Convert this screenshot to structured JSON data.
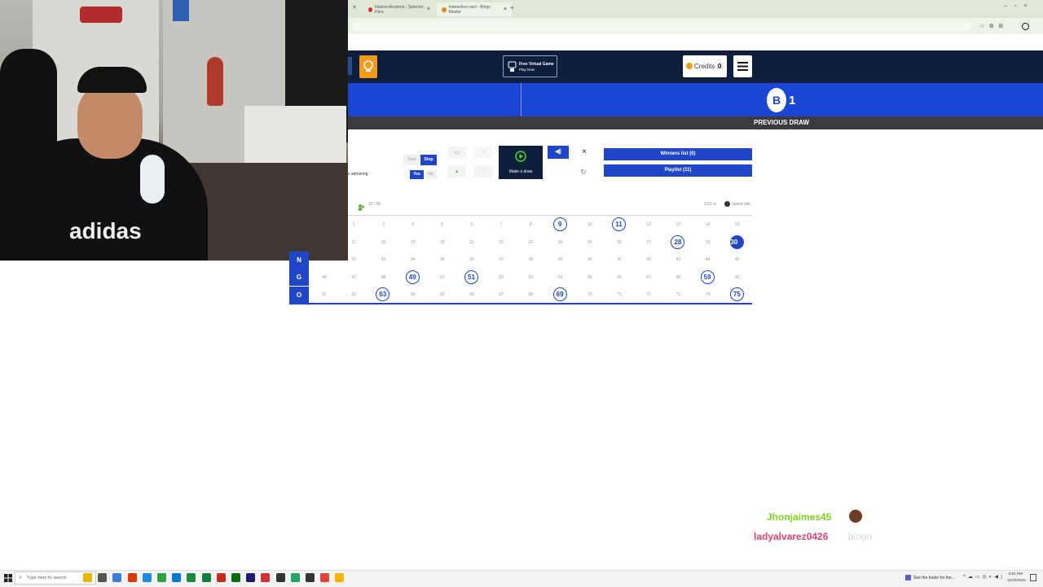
{
  "browser": {
    "tabs": [
      {
        "title": "Nuleva Aleatoria - Selector Peru",
        "color": "#d33030"
      },
      {
        "title": "Interactive card - Bingo Master",
        "color": "#e08a1e"
      }
    ],
    "new_tab_label": "+",
    "close_label": "×"
  },
  "header": {
    "promo_title": "Free Virtual Game",
    "promo_sub": "Play Now",
    "credits_label": "Credits :",
    "credits_value": "0"
  },
  "banner": {
    "last_letter": "B",
    "last_number": "1",
    "previous_label": "PREVIOUS DRAW"
  },
  "controls": {
    "start_label": "Start",
    "stop_label": "Stop",
    "yes_label": "Yes",
    "no_label": "No",
    "adm_text": "s adminıng",
    "make_draw_label": "Make a draw",
    "close_label": "×",
    "winners_label": "Winners list (0)",
    "playlist_label": "Playlist (11)"
  },
  "status": {
    "drawn_count": "32 / 50",
    "timer": "2:52 m",
    "game_info_label": "Game info"
  },
  "board": {
    "rows": [
      {
        "letter": "",
        "numbers": [
          2,
          3,
          4,
          5,
          6,
          7,
          8,
          9,
          10,
          11,
          12,
          13,
          14,
          15
        ]
      },
      {
        "letter": "",
        "numbers": [
          17,
          18,
          19,
          20,
          21,
          22,
          23,
          24,
          25,
          26,
          27,
          28,
          29,
          30
        ]
      },
      {
        "letter": "N",
        "numbers": [
          32,
          33,
          34,
          35,
          36,
          37,
          38,
          39,
          40,
          41,
          42,
          43,
          44,
          45
        ]
      },
      {
        "letter": "G",
        "numbers": [
          46,
          47,
          48,
          49,
          50,
          51,
          52,
          53,
          54,
          55,
          56,
          57,
          58,
          59,
          60
        ]
      },
      {
        "letter": "O",
        "numbers": [
          61,
          62,
          63,
          64,
          65,
          66,
          67,
          68,
          69,
          70,
          71,
          72,
          73,
          74,
          75
        ]
      }
    ],
    "called": [
      9,
      11,
      28,
      49,
      51,
      59,
      63,
      69,
      75
    ],
    "last_called": [
      30
    ]
  },
  "chat": [
    {
      "user": "Jhonjaimes45",
      "color": "#7ed321",
      "message": ""
    },
    {
      "user": "ladyalvarez0426",
      "color": "#e0436b",
      "message": "bingo"
    }
  ],
  "taskbar": {
    "search_placeholder": "Type here to search",
    "tray_text": "See the trailer for the...",
    "time": "6:51 PM",
    "date": "12/22/2023"
  },
  "webcam": {
    "shirt_text": "adidas"
  }
}
